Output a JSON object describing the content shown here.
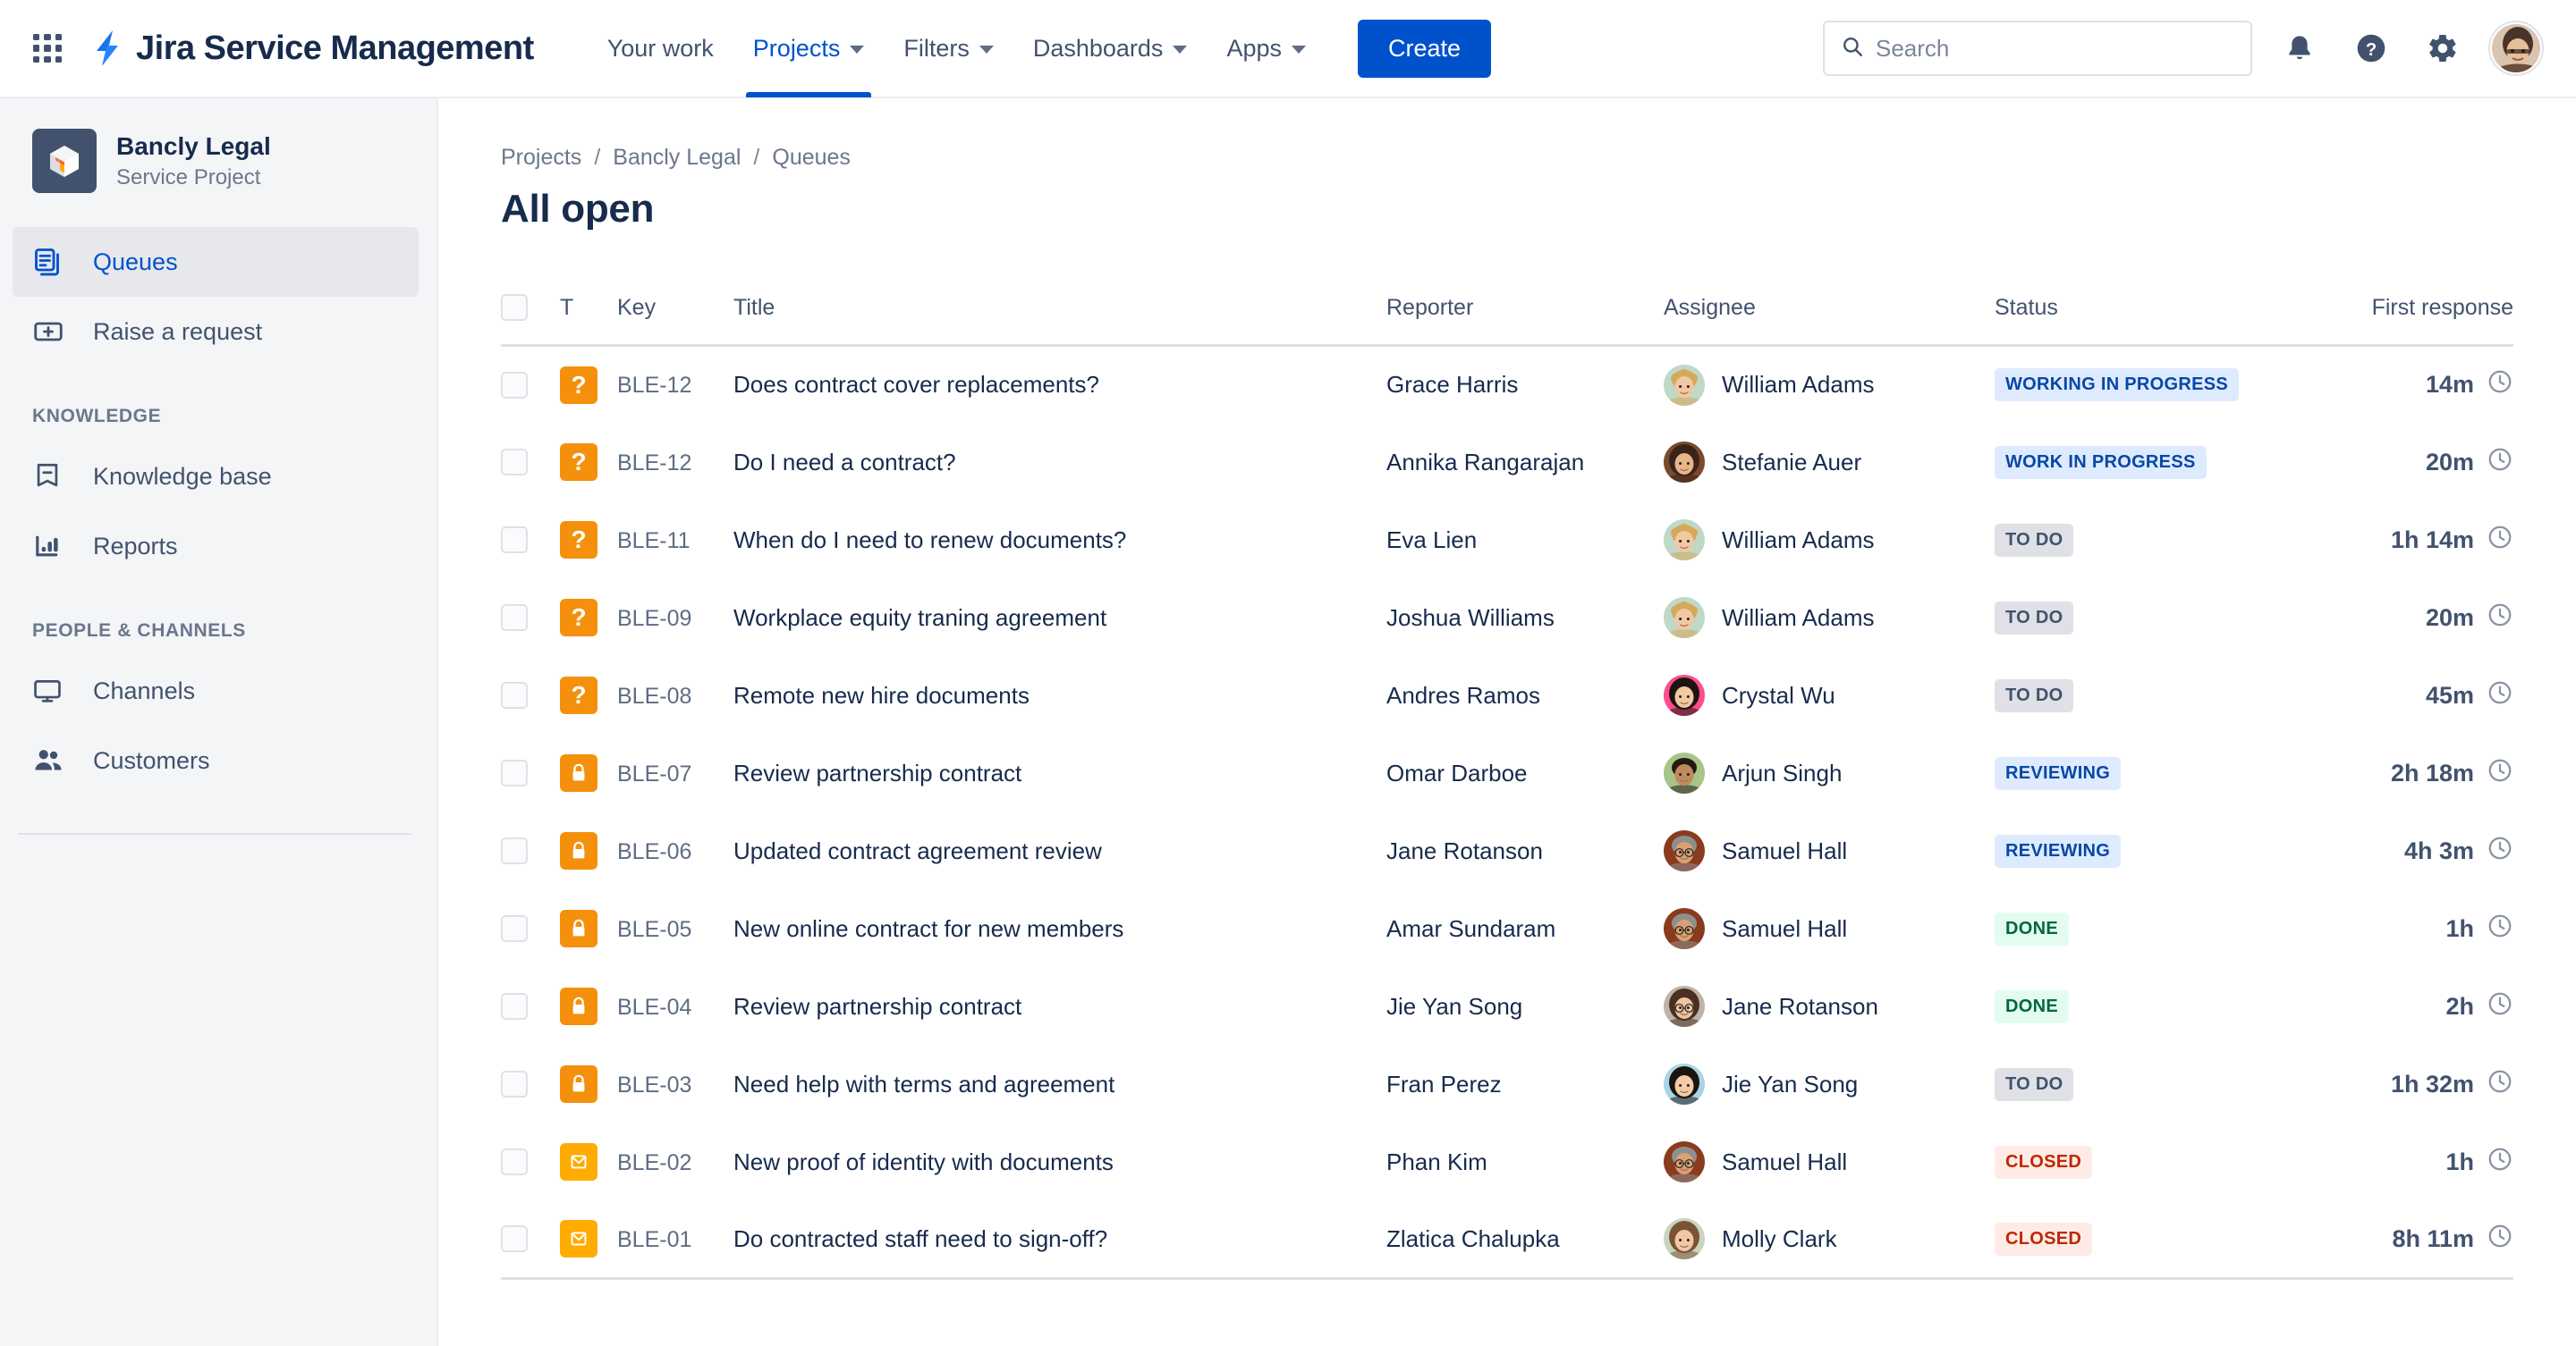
{
  "topnav": {
    "app_switcher_icon": "grid-apps-icon",
    "product_logo_icon": "jira-bolt-icon",
    "product_name": "Jira Service Management",
    "links": [
      {
        "label": "Your work",
        "has_caret": false,
        "active": false
      },
      {
        "label": "Projects",
        "has_caret": true,
        "active": true
      },
      {
        "label": "Filters",
        "has_caret": true,
        "active": false
      },
      {
        "label": "Dashboards",
        "has_caret": true,
        "active": false
      },
      {
        "label": "Apps",
        "has_caret": true,
        "active": false
      }
    ],
    "create_label": "Create",
    "search": {
      "placeholder": "Search",
      "value": "",
      "icon": "search-icon"
    },
    "notifications_icon": "bell-icon",
    "help_icon": "help-circle-icon",
    "settings_icon": "gear-icon",
    "profile_avatar": "user-avatar"
  },
  "sidebar": {
    "project": {
      "name": "Bancly Legal",
      "type": "Service Project",
      "logo_icon": "project-cube-icon"
    },
    "items": [
      {
        "label": "Queues",
        "icon": "queues-icon",
        "selected": true
      },
      {
        "label": "Raise a request",
        "icon": "raise-request-icon",
        "selected": false
      }
    ],
    "groups": [
      {
        "label": "KNOWLEDGE",
        "items": [
          {
            "label": "Knowledge base",
            "icon": "book-icon",
            "selected": false
          },
          {
            "label": "Reports",
            "icon": "chart-icon",
            "selected": false
          }
        ]
      },
      {
        "label": "PEOPLE & CHANNELS",
        "items": [
          {
            "label": "Channels",
            "icon": "monitor-icon",
            "selected": false
          },
          {
            "label": "Customers",
            "icon": "people-icon",
            "selected": false
          }
        ]
      }
    ]
  },
  "main": {
    "breadcrumb": [
      "Projects",
      "Bancly Legal",
      "Queues"
    ],
    "breadcrumb_separator": "/",
    "page_title": "All open",
    "table": {
      "columns": [
        "",
        "T",
        "Key",
        "Title",
        "Reporter",
        "Assignee",
        "Status",
        "First response"
      ],
      "select_all_checkbox": false,
      "rows": [
        {
          "key": "BLE-12",
          "type_icon": "question-icon",
          "type_color": "#F5900C",
          "title": "Does contract cover replacements?",
          "reporter": "Grace Harris",
          "assignee": "William Adams",
          "avatar": "avatar-william",
          "status": "WORKING IN PROGRESS",
          "status_tone": "blue",
          "first_response": "14m"
        },
        {
          "key": "BLE-12",
          "type_icon": "question-icon",
          "type_color": "#F5900C",
          "title": "Do I need a contract?",
          "reporter": "Annika Rangarajan",
          "assignee": "Stefanie Auer",
          "avatar": "avatar-stefanie",
          "status": "WORK IN PROGRESS",
          "status_tone": "blue",
          "first_response": "20m"
        },
        {
          "key": "BLE-11",
          "type_icon": "question-icon",
          "type_color": "#F5900C",
          "title": "When do I need to renew documents?",
          "reporter": "Eva Lien",
          "assignee": "William Adams",
          "avatar": "avatar-william",
          "status": "TO DO",
          "status_tone": "grey",
          "first_response": "1h 14m"
        },
        {
          "key": "BLE-09",
          "type_icon": "question-icon",
          "type_color": "#F5900C",
          "title": "Workplace equity traning agreement",
          "reporter": "Joshua Williams",
          "assignee": "William Adams",
          "avatar": "avatar-william",
          "status": "TO DO",
          "status_tone": "grey",
          "first_response": "20m"
        },
        {
          "key": "BLE-08",
          "type_icon": "question-icon",
          "type_color": "#F5900C",
          "title": "Remote new hire documents",
          "reporter": "Andres Ramos",
          "assignee": "Crystal Wu",
          "avatar": "avatar-crystal",
          "status": "TO DO",
          "status_tone": "grey",
          "first_response": "45m"
        },
        {
          "key": "BLE-07",
          "type_icon": "lock-icon",
          "type_color": "#F5900C",
          "title": "Review partnership contract",
          "reporter": "Omar Darboe",
          "assignee": "Arjun Singh",
          "avatar": "avatar-arjun",
          "status": "REVIEWING",
          "status_tone": "blue",
          "first_response": "2h 18m"
        },
        {
          "key": "BLE-06",
          "type_icon": "lock-icon",
          "type_color": "#F5900C",
          "title": "Updated contract agreement review",
          "reporter": "Jane Rotanson",
          "assignee": "Samuel Hall",
          "avatar": "avatar-samuel",
          "status": "REVIEWING",
          "status_tone": "blue",
          "first_response": "4h 3m"
        },
        {
          "key": "BLE-05",
          "type_icon": "lock-icon",
          "type_color": "#F5900C",
          "title": "New online contract for new members",
          "reporter": "Amar Sundaram",
          "assignee": "Samuel Hall",
          "avatar": "avatar-samuel",
          "status": "DONE",
          "status_tone": "green",
          "first_response": "1h"
        },
        {
          "key": "BLE-04",
          "type_icon": "lock-icon",
          "type_color": "#F5900C",
          "title": "Review partnership contract",
          "reporter": "Jie Yan Song",
          "assignee": "Jane Rotanson",
          "avatar": "avatar-jane",
          "status": "DONE",
          "status_tone": "green",
          "first_response": "2h"
        },
        {
          "key": "BLE-03",
          "type_icon": "lock-icon",
          "type_color": "#F5900C",
          "title": "Need help with terms and agreement",
          "reporter": "Fran Perez",
          "assignee": "Jie Yan Song",
          "avatar": "avatar-jie",
          "status": "TO DO",
          "status_tone": "grey",
          "first_response": "1h 32m"
        },
        {
          "key": "BLE-02",
          "type_icon": "envelope-icon",
          "type_color": "#FFAB00",
          "title": "New proof of identity with documents",
          "reporter": "Phan Kim",
          "assignee": "Samuel Hall",
          "avatar": "avatar-samuel",
          "status": "CLOSED",
          "status_tone": "red",
          "first_response": "1h"
        },
        {
          "key": "BLE-01",
          "type_icon": "envelope-icon",
          "type_color": "#FFAB00",
          "title": "Do contracted staff need to sign-off?",
          "reporter": "Zlatica Chalupka",
          "assignee": "Molly Clark",
          "avatar": "avatar-molly",
          "status": "CLOSED",
          "status_tone": "red",
          "first_response": "8h 11m"
        }
      ]
    }
  },
  "colors": {
    "brand_blue": "#0052CC",
    "text_primary": "#172B4D",
    "text_subtle": "#6B778C",
    "sidebar_bg": "#F4F5F7",
    "type_orange": "#F5900C",
    "type_yellow": "#FFAB00"
  }
}
